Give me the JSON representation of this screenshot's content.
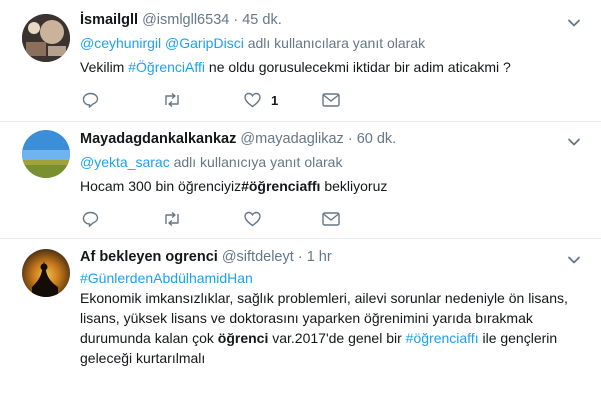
{
  "tweets": [
    {
      "fullname": "İsmailgll",
      "handle": "@ismlgll6534",
      "sep": "·",
      "time": "45 dk.",
      "reply_users": "@ceyhunirgil @GaripDisci",
      "reply_suffix": "adlı kullanıcılara yanıt olarak",
      "text_before": "Vekilim ",
      "hashtag": "#ÖğrenciAffi",
      "text_after": " ne oldu gorusulecekmi iktidar bir adim aticakmi ?",
      "like_count": "1"
    },
    {
      "fullname": "Mayadagdankalkankaz",
      "handle": "@mayadaglikaz",
      "sep": "·",
      "time": "60 dk.",
      "reply_users": "@yekta_sarac",
      "reply_suffix": "adlı kullanıcıya yanıt olarak",
      "text_before": "Hocam 300 bin öğrenciyiz",
      "hashtag_bold": "#öğrenciaffı",
      "text_after": " bekliyoruz"
    },
    {
      "fullname": "Af bekleyen ogrenci",
      "handle": "@siftdeleyt",
      "sep": "·",
      "time": "1 hr",
      "hashtag_line": "#GünlerdenAbdülhamidHan",
      "body_1": "Ekonomik imkansızlıklar, sağlık problemleri, ailevi sorunlar nedeniyle ön lisans, lisans, yüksek lisans ve doktorasını yaparken öğrenimini yarıda bırakmak durumunda kalan çok  ",
      "bold_word": "öğrenci",
      "body_2": " var.2017'de genel bir  ",
      "hashtag_inline": "#öğrenciaffı",
      "body_3": " ile gençlerin geleceği kurtarılmalı"
    }
  ],
  "colors": {
    "link": "#1da1f2",
    "muted": "#657786",
    "divider": "#e6ecf0"
  }
}
